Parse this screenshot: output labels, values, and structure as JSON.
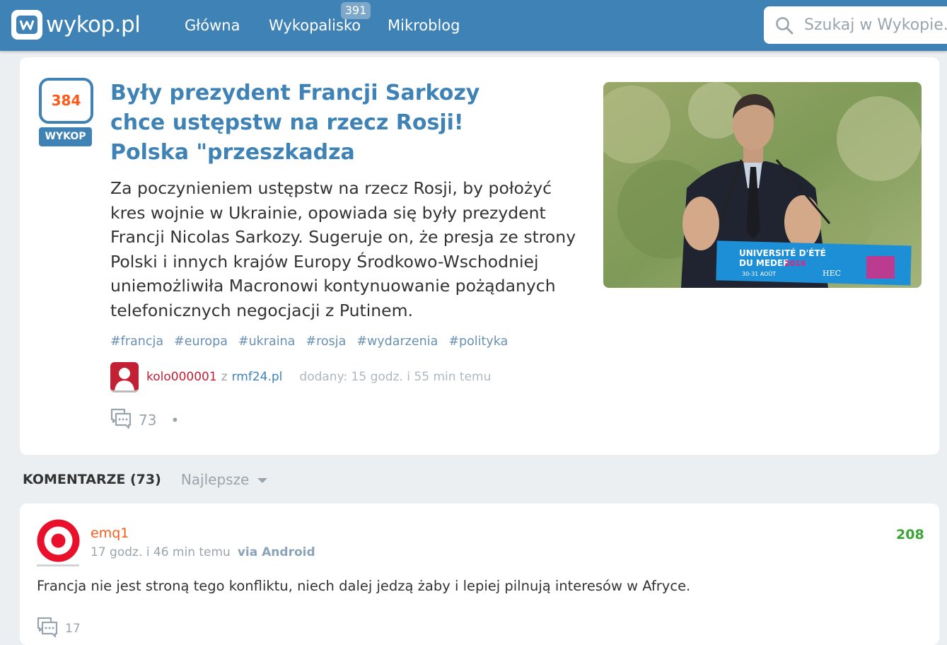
{
  "header": {
    "logo_text": "wykop.pl",
    "nav": [
      {
        "label": "Główna"
      },
      {
        "label": "Wykopalisko",
        "badge": "391"
      },
      {
        "label": "Mikroblog"
      }
    ],
    "search_placeholder": "Szukaj w Wykopie..."
  },
  "article": {
    "votes": "384",
    "vote_button": "WYKOP",
    "title": "Były prezydent Francji Sarkozy chce ustępstw na rzecz Rosji! Polska \"przeszkadza",
    "description": "Za poczynieniem ustępstw na rzecz Rosji, by położyć kres wojnie w Ukrainie, opowiada się były prezydent Francji Nicolas Sarkozy. Sugeruje on, że presja ze strony Polski i innych krajów Europy Środkowo-Wschodniej uniemożliwiła Macronowi kontynuowanie pożądanych telefonicznych negocjacji z Putinem.",
    "tags": [
      "#francja",
      "#europa",
      "#ukraina",
      "#rosja",
      "#wydarzenia",
      "#polityka"
    ],
    "author": "kolo000001",
    "from_word": "z",
    "source": "rmf24.pl",
    "added": "dodany: 15 godz. i 55 min temu",
    "comments_count": "73",
    "dot": "•",
    "image": {
      "banner_line1": "UNIVERSITÉ D'ÉTÉ",
      "banner_line2": "DU MEDEF",
      "banner_year": "2016",
      "banner_dates": "30-31 AOÛT",
      "banner_brand": "HEC"
    }
  },
  "comments_section": {
    "title": "KOMENTARZE (73)",
    "sort": "Najlepsze"
  },
  "comment": {
    "user": "emq1",
    "time": "17 godz. i 46 min temu",
    "via": "via Android",
    "score": "208",
    "text": "Francja nie jest stroną tego konfliktu, niech dalej jedzą żaby i lepiej pilnują interesów w Afryce.",
    "replies": "17"
  },
  "colors": {
    "brand": "#3f83b6",
    "orange": "#ff5917",
    "author_red": "#c22034",
    "score_green": "#3aa535"
  }
}
